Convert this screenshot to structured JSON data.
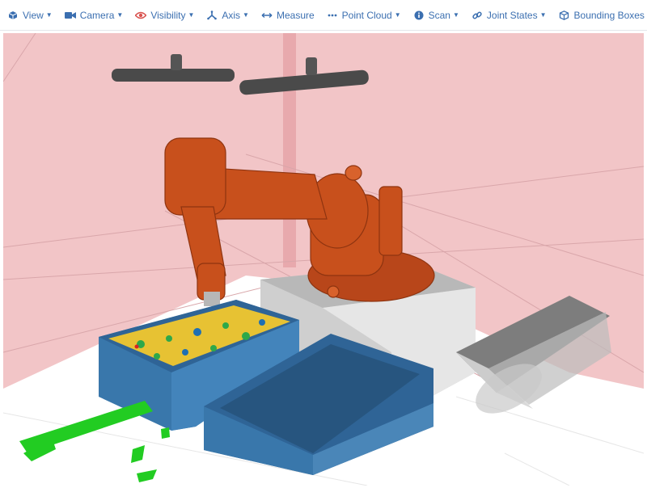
{
  "toolbar": {
    "view": "View",
    "camera": "Camera",
    "visibility": "Visibility",
    "axis": "Axis",
    "measure": "Measure",
    "point_cloud": "Point Cloud",
    "scan": "Scan",
    "joint_states": "Joint States",
    "bounding_boxes": "Bounding Boxes"
  },
  "icons": {
    "view": "cube-icon",
    "camera": "video-camera-icon",
    "visibility": "eye-icon",
    "axis": "axis-icon",
    "measure": "arrows-horizontal-icon",
    "point_cloud": "dots-icon",
    "scan": "info-circle-icon",
    "joint_states": "link-icon",
    "bounding_boxes": "cubes-icon"
  },
  "colors": {
    "toolbar_text": "#3b6fb0",
    "visibility_icon": "#d9534f",
    "robot": "#c8501c",
    "wall": "#f0c4c6",
    "bin": "#3c78ad",
    "conveyor": "#8a8a8a",
    "point_cloud": "#22cc22"
  }
}
